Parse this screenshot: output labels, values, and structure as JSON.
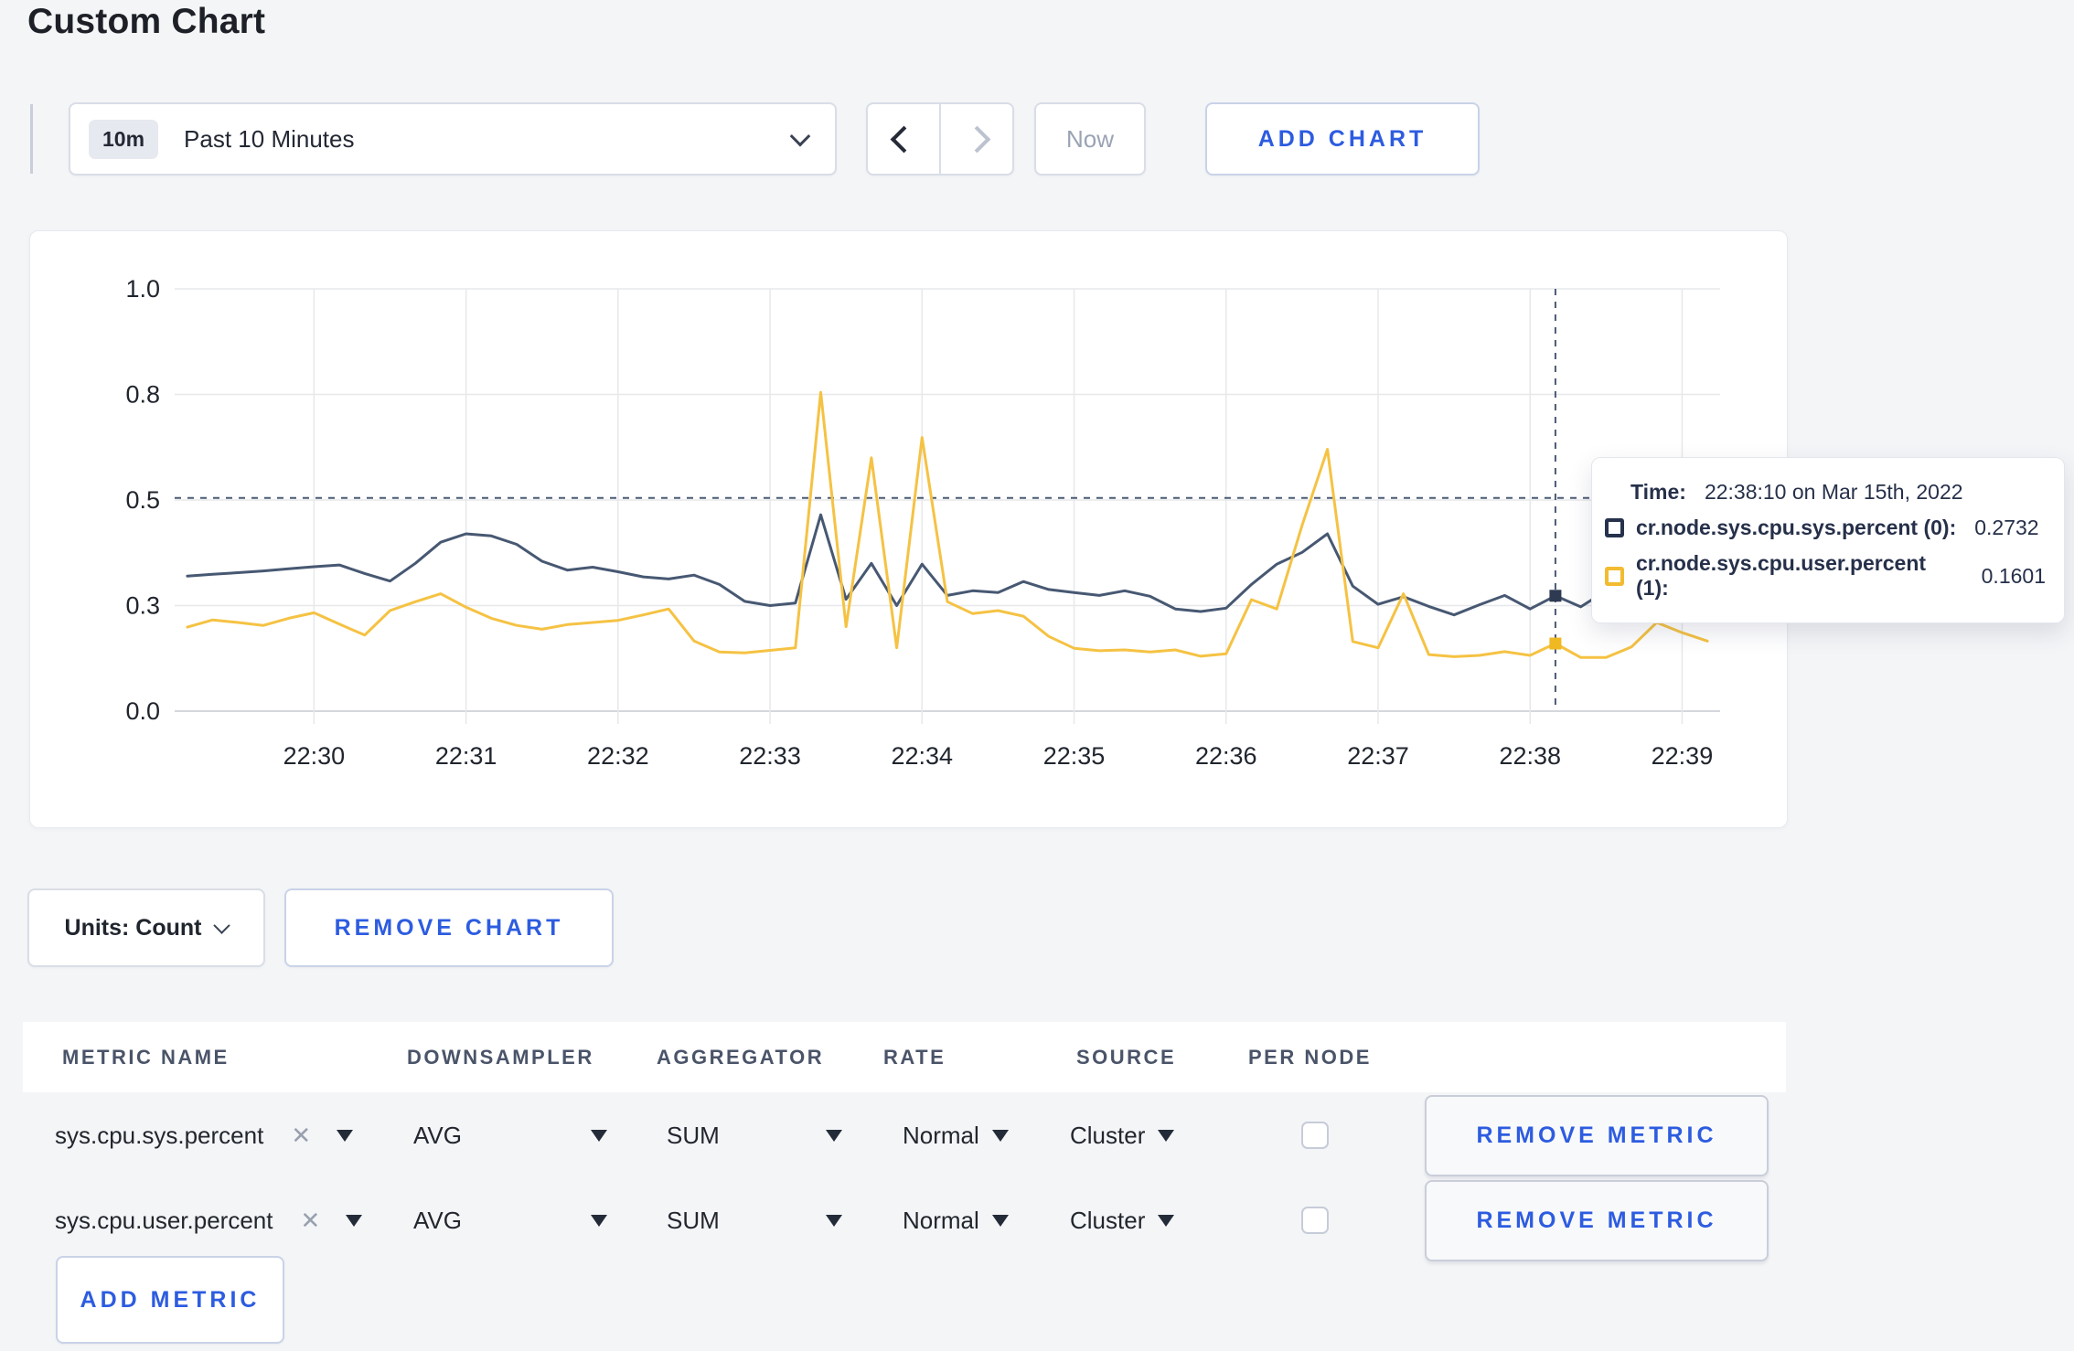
{
  "title": "Custom Chart",
  "toolbar": {
    "time_range_badge": "10m",
    "time_range_label": "Past 10 Minutes",
    "now_label": "Now",
    "add_chart_label": "ADD CHART"
  },
  "chart_controls": {
    "units_label": "Units: Count",
    "remove_chart_label": "REMOVE CHART",
    "add_metric_label": "ADD METRIC"
  },
  "tooltip": {
    "time_label": "Time:",
    "time_value": "22:38:10 on Mar 15th, 2022",
    "series": [
      {
        "label": "cr.node.sys.cpu.sys.percent (0):",
        "value": "0.2732",
        "color": "#26324c"
      },
      {
        "label": "cr.node.sys.cpu.user.percent (1):",
        "value": "0.1601",
        "color": "#f2bb30"
      }
    ]
  },
  "metrics_table": {
    "columns": [
      "METRIC NAME",
      "DOWNSAMPLER",
      "AGGREGATOR",
      "RATE",
      "SOURCE",
      "PER NODE"
    ],
    "rows": [
      {
        "name": "sys.cpu.sys.percent",
        "downsampler": "AVG",
        "aggregator": "SUM",
        "rate": "Normal",
        "source": "Cluster",
        "per_node": false,
        "remove_label": "REMOVE METRIC"
      },
      {
        "name": "sys.cpu.user.percent",
        "downsampler": "AVG",
        "aggregator": "SUM",
        "rate": "Normal",
        "source": "Cluster",
        "per_node": false,
        "remove_label": "REMOVE METRIC"
      }
    ]
  },
  "chart_data": {
    "type": "line",
    "title": "",
    "xlabel": "",
    "ylabel": "",
    "ylim": [
      0,
      1
    ],
    "grid": true,
    "legend_position": "none",
    "y_ticks": [
      {
        "value": 0,
        "label": "0.0"
      },
      {
        "value": 0.25,
        "label": "0.3"
      },
      {
        "value": 0.5,
        "label": "0.5"
      },
      {
        "value": 0.75,
        "label": "0.8"
      },
      {
        "value": 1,
        "label": "1.0"
      }
    ],
    "x_tick_labels": [
      "22:30",
      "22:31",
      "22:32",
      "22:33",
      "22:34",
      "22:35",
      "22:36",
      "22:37",
      "22:38",
      "22:39"
    ],
    "x_times": [
      "22:29:10",
      "22:29:20",
      "22:29:30",
      "22:29:40",
      "22:29:50",
      "22:30:00",
      "22:30:10",
      "22:30:20",
      "22:30:30",
      "22:30:40",
      "22:30:50",
      "22:31:00",
      "22:31:10",
      "22:31:20",
      "22:31:30",
      "22:31:40",
      "22:31:50",
      "22:32:00",
      "22:32:10",
      "22:32:20",
      "22:32:30",
      "22:32:40",
      "22:32:50",
      "22:33:00",
      "22:33:10",
      "22:33:20",
      "22:33:30",
      "22:33:40",
      "22:33:50",
      "22:34:00",
      "22:34:10",
      "22:34:20",
      "22:34:30",
      "22:34:40",
      "22:34:50",
      "22:35:00",
      "22:35:10",
      "22:35:20",
      "22:35:30",
      "22:35:40",
      "22:35:50",
      "22:36:00",
      "22:36:10",
      "22:36:20",
      "22:36:30",
      "22:36:40",
      "22:36:50",
      "22:37:00",
      "22:37:10",
      "22:37:20",
      "22:37:30",
      "22:37:40",
      "22:37:50",
      "22:38:00",
      "22:38:10",
      "22:38:20",
      "22:38:30",
      "22:38:40",
      "22:38:50",
      "22:39:00",
      "22:39:10"
    ],
    "series": [
      {
        "name": "cr.node.sys.cpu.sys.percent",
        "color": "#475872",
        "values": [
          0.32,
          0.324,
          0.328,
          0.332,
          0.337,
          0.342,
          0.346,
          0.326,
          0.308,
          0.35,
          0.4,
          0.42,
          0.415,
          0.395,
          0.355,
          0.334,
          0.341,
          0.33,
          0.318,
          0.313,
          0.322,
          0.3,
          0.26,
          0.25,
          0.256,
          0.465,
          0.265,
          0.35,
          0.25,
          0.348,
          0.274,
          0.285,
          0.281,
          0.307,
          0.288,
          0.281,
          0.274,
          0.285,
          0.272,
          0.242,
          0.236,
          0.244,
          0.3,
          0.348,
          0.376,
          0.42,
          0.296,
          0.253,
          0.271,
          0.248,
          0.228,
          0.252,
          0.274,
          0.242,
          0.2732,
          0.247,
          0.285,
          0.3,
          0.292,
          0.305,
          0.298
        ]
      },
      {
        "name": "cr.node.sys.cpu.user.percent",
        "color": "#f5c243",
        "values": [
          0.199,
          0.216,
          0.21,
          0.203,
          0.22,
          0.233,
          0.206,
          0.18,
          0.238,
          0.259,
          0.278,
          0.246,
          0.22,
          0.203,
          0.194,
          0.205,
          0.21,
          0.215,
          0.228,
          0.242,
          0.166,
          0.14,
          0.138,
          0.144,
          0.15,
          0.755,
          0.2,
          0.6,
          0.15,
          0.648,
          0.259,
          0.231,
          0.238,
          0.225,
          0.177,
          0.149,
          0.143,
          0.145,
          0.14,
          0.145,
          0.13,
          0.136,
          0.264,
          0.242,
          0.44,
          0.62,
          0.165,
          0.15,
          0.278,
          0.134,
          0.129,
          0.132,
          0.141,
          0.132,
          0.1601,
          0.127,
          0.127,
          0.152,
          0.21,
          0.186,
          0.166
        ]
      }
    ],
    "crosshair": {
      "time": "22:38:10",
      "hline_value": 0.505
    }
  },
  "colors": {
    "accent_blue": "#2d5ce0",
    "page_bg": "#f4f5f7",
    "grid": "#e7e8ec",
    "axis": "#d4d7dc",
    "crosshair": "#4a5a74",
    "marker_sys": "#2e3a52",
    "marker_user": "#f0b821"
  }
}
